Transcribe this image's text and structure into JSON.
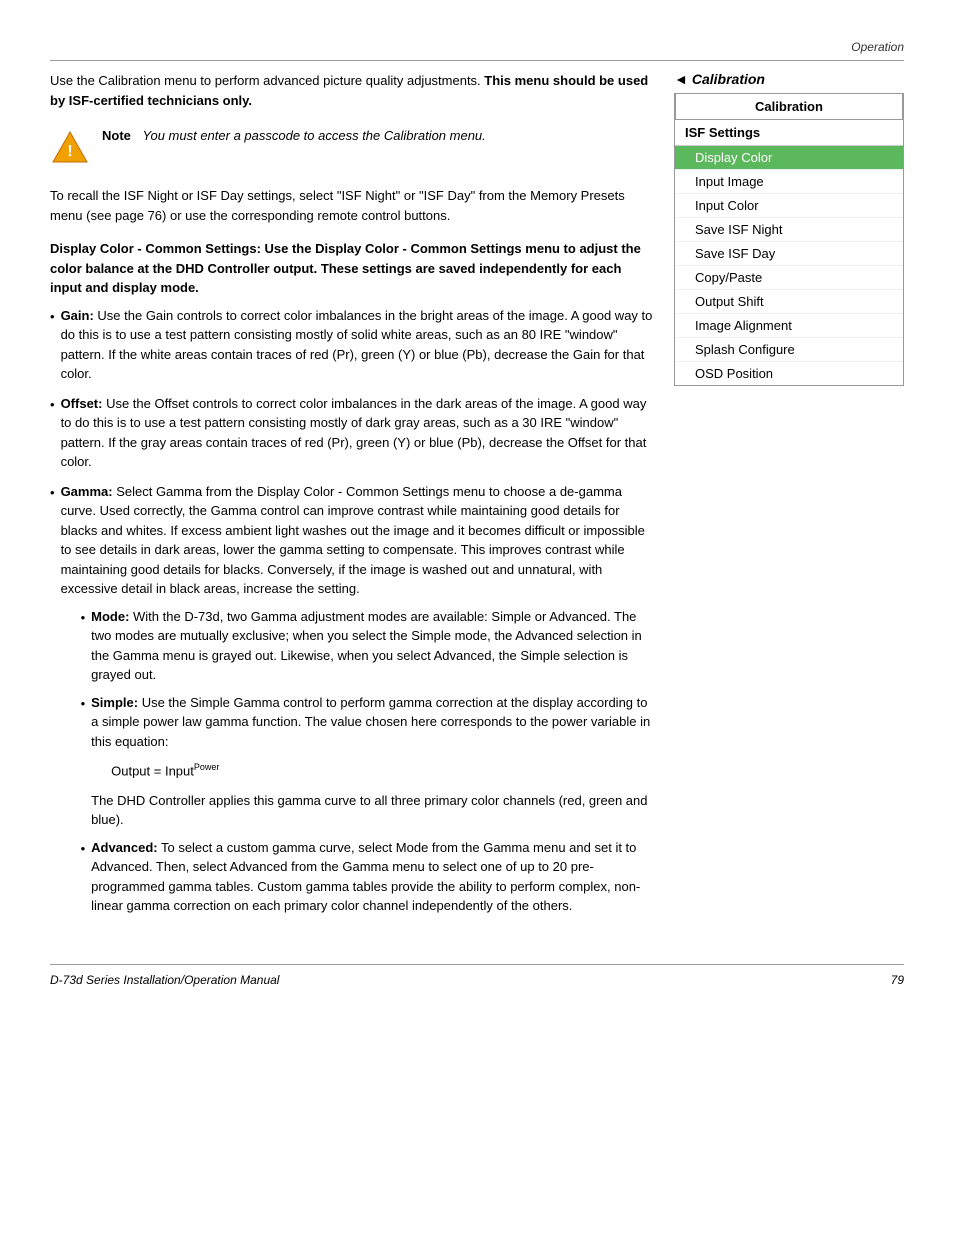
{
  "page": {
    "header": "Operation",
    "footer_left": "D-73d Series Installation/Operation Manual",
    "footer_page": "79"
  },
  "intro": {
    "text_normal": "Use the Calibration menu to perform advanced picture quality adjustments. ",
    "text_bold": "This menu should be used by ISF-certified technicians only."
  },
  "note": {
    "label": "Note",
    "text": "You must enter a passcode to access the Calibration menu."
  },
  "recall_text": "To recall the ISF Night or ISF Day settings, select \"ISF Night\" or \"ISF Day\" from the Memory Presets menu (see page 76) or use the corresponding remote control buttons.",
  "display_color_section": {
    "heading": "Display Color - Common Settings:",
    "heading_continuation": " Use the Display Color - Common Settings menu to adjust the color balance at the DHD Controller output. These settings are saved independently for each input and display mode."
  },
  "bullets": [
    {
      "term": "Gain:",
      "text": " Use the Gain controls to correct color imbalances in the bright areas of the image. A good way to do this is to use a test pattern consisting mostly of solid white areas, such as an 80 IRE \"window\" pattern. If the white areas contain traces of red (Pr), green (Y) or blue (Pb), decrease the Gain for that color."
    },
    {
      "term": "Offset:",
      "text": " Use the Offset controls to correct color imbalances in the dark areas of the image. A good way to do this is to use a test pattern consisting mostly of dark gray areas, such as a 30 IRE \"window\" pattern. If the gray areas contain traces of red (Pr), green (Y) or blue (Pb), decrease the Offset for that color."
    },
    {
      "term": "Gamma:",
      "text": " Select Gamma from the Display Color - Common Settings menu to choose a de-gamma curve. Used correctly, the Gamma control can improve contrast while maintaining good details for blacks and whites. If excess ambient light washes out the image and it becomes difficult or impossible to see details in dark areas, lower the gamma setting to compensate. This improves contrast while maintaining good details for blacks. Conversely, if the image is washed out and unnatural, with excessive detail in black areas, increase the setting.",
      "sub_bullets": [
        {
          "term": "Mode:",
          "text": " With the D-73d, two Gamma adjustment modes are available: Simple or Advanced. The two modes are mutually exclusive; when you select the Simple mode, the Advanced selection in the Gamma menu is grayed out. Likewise, when you select Advanced, the Simple selection is grayed out."
        },
        {
          "term": "Simple:",
          "text": " Use the Simple Gamma control to perform gamma correction at the display according to a simple power law gamma function. The value chosen here corresponds to the power variable in this equation:"
        }
      ],
      "equation": {
        "text": "Output = Input",
        "superscript": "Power"
      },
      "after_equation": "The DHD Controller applies this gamma curve to all three primary color channels (red, green and blue).",
      "sub_bullets_2": [
        {
          "term": "Advanced:",
          "text": " To select a custom gamma curve, select Mode from the Gamma menu and set it to Advanced. Then, select Advanced from the Gamma menu to select one of up to 20 pre-programmed gamma tables. Custom gamma tables provide the ability to perform complex, non-linear gamma correction on each primary color channel independently of the others."
        }
      ]
    }
  ],
  "sidebar": {
    "title_label": "Calibration",
    "arrow": "◄",
    "title_italic": "Calibration",
    "menu_header": "Calibration",
    "group_header": "ISF Settings",
    "items": [
      {
        "label": "Display Color",
        "active": true
      },
      {
        "label": "Input Image",
        "active": false
      },
      {
        "label": "Input Color",
        "active": false
      },
      {
        "label": "Save ISF Night",
        "active": false
      },
      {
        "label": "Save ISF Day",
        "active": false
      },
      {
        "label": "Copy/Paste",
        "active": false
      },
      {
        "label": "Output Shift",
        "active": false
      },
      {
        "label": "Image Alignment",
        "active": false
      },
      {
        "label": "Splash Configure",
        "active": false
      },
      {
        "label": "OSD Position",
        "active": false
      }
    ]
  }
}
